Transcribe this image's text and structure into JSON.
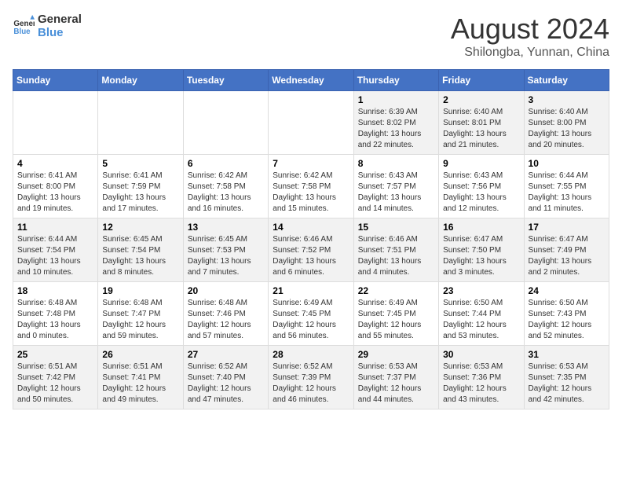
{
  "logo": {
    "line1": "General",
    "line2": "Blue"
  },
  "title": "August 2024",
  "subtitle": "Shilongba, Yunnan, China",
  "days_of_week": [
    "Sunday",
    "Monday",
    "Tuesday",
    "Wednesday",
    "Thursday",
    "Friday",
    "Saturday"
  ],
  "weeks": [
    [
      {
        "day": "",
        "info": ""
      },
      {
        "day": "",
        "info": ""
      },
      {
        "day": "",
        "info": ""
      },
      {
        "day": "",
        "info": ""
      },
      {
        "day": "1",
        "info": "Sunrise: 6:39 AM\nSunset: 8:02 PM\nDaylight: 13 hours and 22 minutes."
      },
      {
        "day": "2",
        "info": "Sunrise: 6:40 AM\nSunset: 8:01 PM\nDaylight: 13 hours and 21 minutes."
      },
      {
        "day": "3",
        "info": "Sunrise: 6:40 AM\nSunset: 8:00 PM\nDaylight: 13 hours and 20 minutes."
      }
    ],
    [
      {
        "day": "4",
        "info": "Sunrise: 6:41 AM\nSunset: 8:00 PM\nDaylight: 13 hours and 19 minutes."
      },
      {
        "day": "5",
        "info": "Sunrise: 6:41 AM\nSunset: 7:59 PM\nDaylight: 13 hours and 17 minutes."
      },
      {
        "day": "6",
        "info": "Sunrise: 6:42 AM\nSunset: 7:58 PM\nDaylight: 13 hours and 16 minutes."
      },
      {
        "day": "7",
        "info": "Sunrise: 6:42 AM\nSunset: 7:58 PM\nDaylight: 13 hours and 15 minutes."
      },
      {
        "day": "8",
        "info": "Sunrise: 6:43 AM\nSunset: 7:57 PM\nDaylight: 13 hours and 14 minutes."
      },
      {
        "day": "9",
        "info": "Sunrise: 6:43 AM\nSunset: 7:56 PM\nDaylight: 13 hours and 12 minutes."
      },
      {
        "day": "10",
        "info": "Sunrise: 6:44 AM\nSunset: 7:55 PM\nDaylight: 13 hours and 11 minutes."
      }
    ],
    [
      {
        "day": "11",
        "info": "Sunrise: 6:44 AM\nSunset: 7:54 PM\nDaylight: 13 hours and 10 minutes."
      },
      {
        "day": "12",
        "info": "Sunrise: 6:45 AM\nSunset: 7:54 PM\nDaylight: 13 hours and 8 minutes."
      },
      {
        "day": "13",
        "info": "Sunrise: 6:45 AM\nSunset: 7:53 PM\nDaylight: 13 hours and 7 minutes."
      },
      {
        "day": "14",
        "info": "Sunrise: 6:46 AM\nSunset: 7:52 PM\nDaylight: 13 hours and 6 minutes."
      },
      {
        "day": "15",
        "info": "Sunrise: 6:46 AM\nSunset: 7:51 PM\nDaylight: 13 hours and 4 minutes."
      },
      {
        "day": "16",
        "info": "Sunrise: 6:47 AM\nSunset: 7:50 PM\nDaylight: 13 hours and 3 minutes."
      },
      {
        "day": "17",
        "info": "Sunrise: 6:47 AM\nSunset: 7:49 PM\nDaylight: 13 hours and 2 minutes."
      }
    ],
    [
      {
        "day": "18",
        "info": "Sunrise: 6:48 AM\nSunset: 7:48 PM\nDaylight: 13 hours and 0 minutes."
      },
      {
        "day": "19",
        "info": "Sunrise: 6:48 AM\nSunset: 7:47 PM\nDaylight: 12 hours and 59 minutes."
      },
      {
        "day": "20",
        "info": "Sunrise: 6:48 AM\nSunset: 7:46 PM\nDaylight: 12 hours and 57 minutes."
      },
      {
        "day": "21",
        "info": "Sunrise: 6:49 AM\nSunset: 7:45 PM\nDaylight: 12 hours and 56 minutes."
      },
      {
        "day": "22",
        "info": "Sunrise: 6:49 AM\nSunset: 7:45 PM\nDaylight: 12 hours and 55 minutes."
      },
      {
        "day": "23",
        "info": "Sunrise: 6:50 AM\nSunset: 7:44 PM\nDaylight: 12 hours and 53 minutes."
      },
      {
        "day": "24",
        "info": "Sunrise: 6:50 AM\nSunset: 7:43 PM\nDaylight: 12 hours and 52 minutes."
      }
    ],
    [
      {
        "day": "25",
        "info": "Sunrise: 6:51 AM\nSunset: 7:42 PM\nDaylight: 12 hours and 50 minutes."
      },
      {
        "day": "26",
        "info": "Sunrise: 6:51 AM\nSunset: 7:41 PM\nDaylight: 12 hours and 49 minutes."
      },
      {
        "day": "27",
        "info": "Sunrise: 6:52 AM\nSunset: 7:40 PM\nDaylight: 12 hours and 47 minutes."
      },
      {
        "day": "28",
        "info": "Sunrise: 6:52 AM\nSunset: 7:39 PM\nDaylight: 12 hours and 46 minutes."
      },
      {
        "day": "29",
        "info": "Sunrise: 6:53 AM\nSunset: 7:37 PM\nDaylight: 12 hours and 44 minutes."
      },
      {
        "day": "30",
        "info": "Sunrise: 6:53 AM\nSunset: 7:36 PM\nDaylight: 12 hours and 43 minutes."
      },
      {
        "day": "31",
        "info": "Sunrise: 6:53 AM\nSunset: 7:35 PM\nDaylight: 12 hours and 42 minutes."
      }
    ]
  ]
}
